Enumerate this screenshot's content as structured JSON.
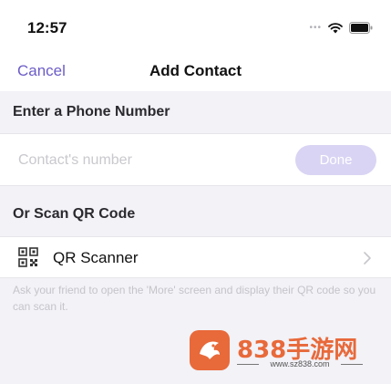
{
  "status_bar": {
    "time": "12:57",
    "icons": [
      "signal-dots",
      "wifi-icon",
      "battery-icon"
    ]
  },
  "nav": {
    "cancel_label": "Cancel",
    "title": "Add Contact"
  },
  "phone_section": {
    "header": "Enter a Phone Number",
    "input_placeholder": "Contact's number",
    "input_value": "",
    "done_label": "Done"
  },
  "qr_section": {
    "header": "Or Scan QR Code",
    "scanner_label": "QR Scanner",
    "scanner_icon": "qr-code-icon",
    "chevron_icon": "chevron-right-icon",
    "helper_text": "Ask your friend to open the 'More' screen and display their QR code so you can scan it."
  },
  "watermark": {
    "title": "838手游网",
    "url": "www.sz838.com"
  },
  "colors": {
    "accent": "#6b5cc7",
    "done_disabled": "#d9d4f3",
    "background": "#f2f2f7",
    "watermark": "#e8693a"
  }
}
